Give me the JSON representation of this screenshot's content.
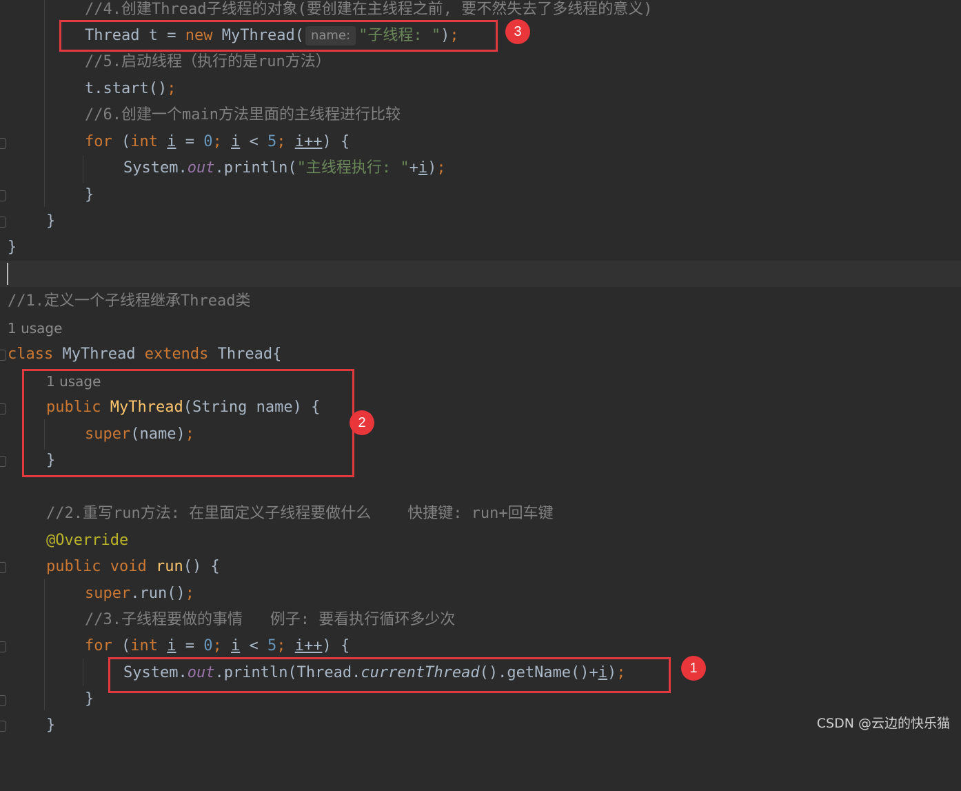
{
  "lines": {
    "l1_comment": "//4.创建Thread子线程的对象(要创建在主线程之前, 要不然失去了多线程的意义)",
    "l2_type": "Thread",
    "l2_var": "t",
    "l2_eq": "=",
    "l2_new": "new",
    "l2_ctor": "MyThread(",
    "l2_hint": "name:",
    "l2_str": "\"子线程: \"",
    "l2_end": ");",
    "l3_comment": "//5.启动线程（执行的是run方法）",
    "l4_code": "t.start()",
    "l5_comment": "//6.创建一个main方法里面的主线程进行比较",
    "for_kw": "for",
    "for_open": "(",
    "int_kw": "int",
    "var_i": "i",
    "assign": "=",
    "zero": "0",
    "lt": "<",
    "five": "5",
    "inc": "i++",
    "for_close": ") {",
    "sys": "System.",
    "out": "out",
    "println": ".println(",
    "l7_str": "\"主线程执行: \"",
    "plus": "+",
    "close_paren": ")",
    "semi": ";",
    "brace": "}",
    "l11_comment": "//1.定义一个子线程继承Thread类",
    "usage": "1 usage",
    "class_kw": "class",
    "class_name": "MyThread",
    "extends_kw": "extends",
    "class_parent": "Thread{",
    "public_kw": "public",
    "ctor_name": "MyThread",
    "ctor_params": "(String name) {",
    "super_kw": "super",
    "super_args": "(name)",
    "l18_comment": "//2.重写run方法: 在里面定义子线程要做什么    快捷键: run+回车键",
    "override": "@Override",
    "void_kw": "void",
    "run_fn": "run",
    "run_rest": "() {",
    "super_run": ".run()",
    "l22_comment": "//3.子线程要做的事情   例子: 要看执行循环多少次",
    "thread_cls": "println(Thread.",
    "current_thread": "currentThread",
    "get_name": "().getName()+"
  },
  "badges": {
    "one": "1",
    "two": "2",
    "three": "3"
  },
  "watermark": "CSDN @云边的快乐猫",
  "colors": {
    "background": "#2b2b2b",
    "keyword": "#cc7832",
    "comment": "#808080",
    "string": "#6a8759",
    "number": "#6897bb",
    "method": "#ffc66d",
    "static_field": "#9876aa",
    "annotation": "#bbb529",
    "highlight_box": "#e0393e"
  }
}
